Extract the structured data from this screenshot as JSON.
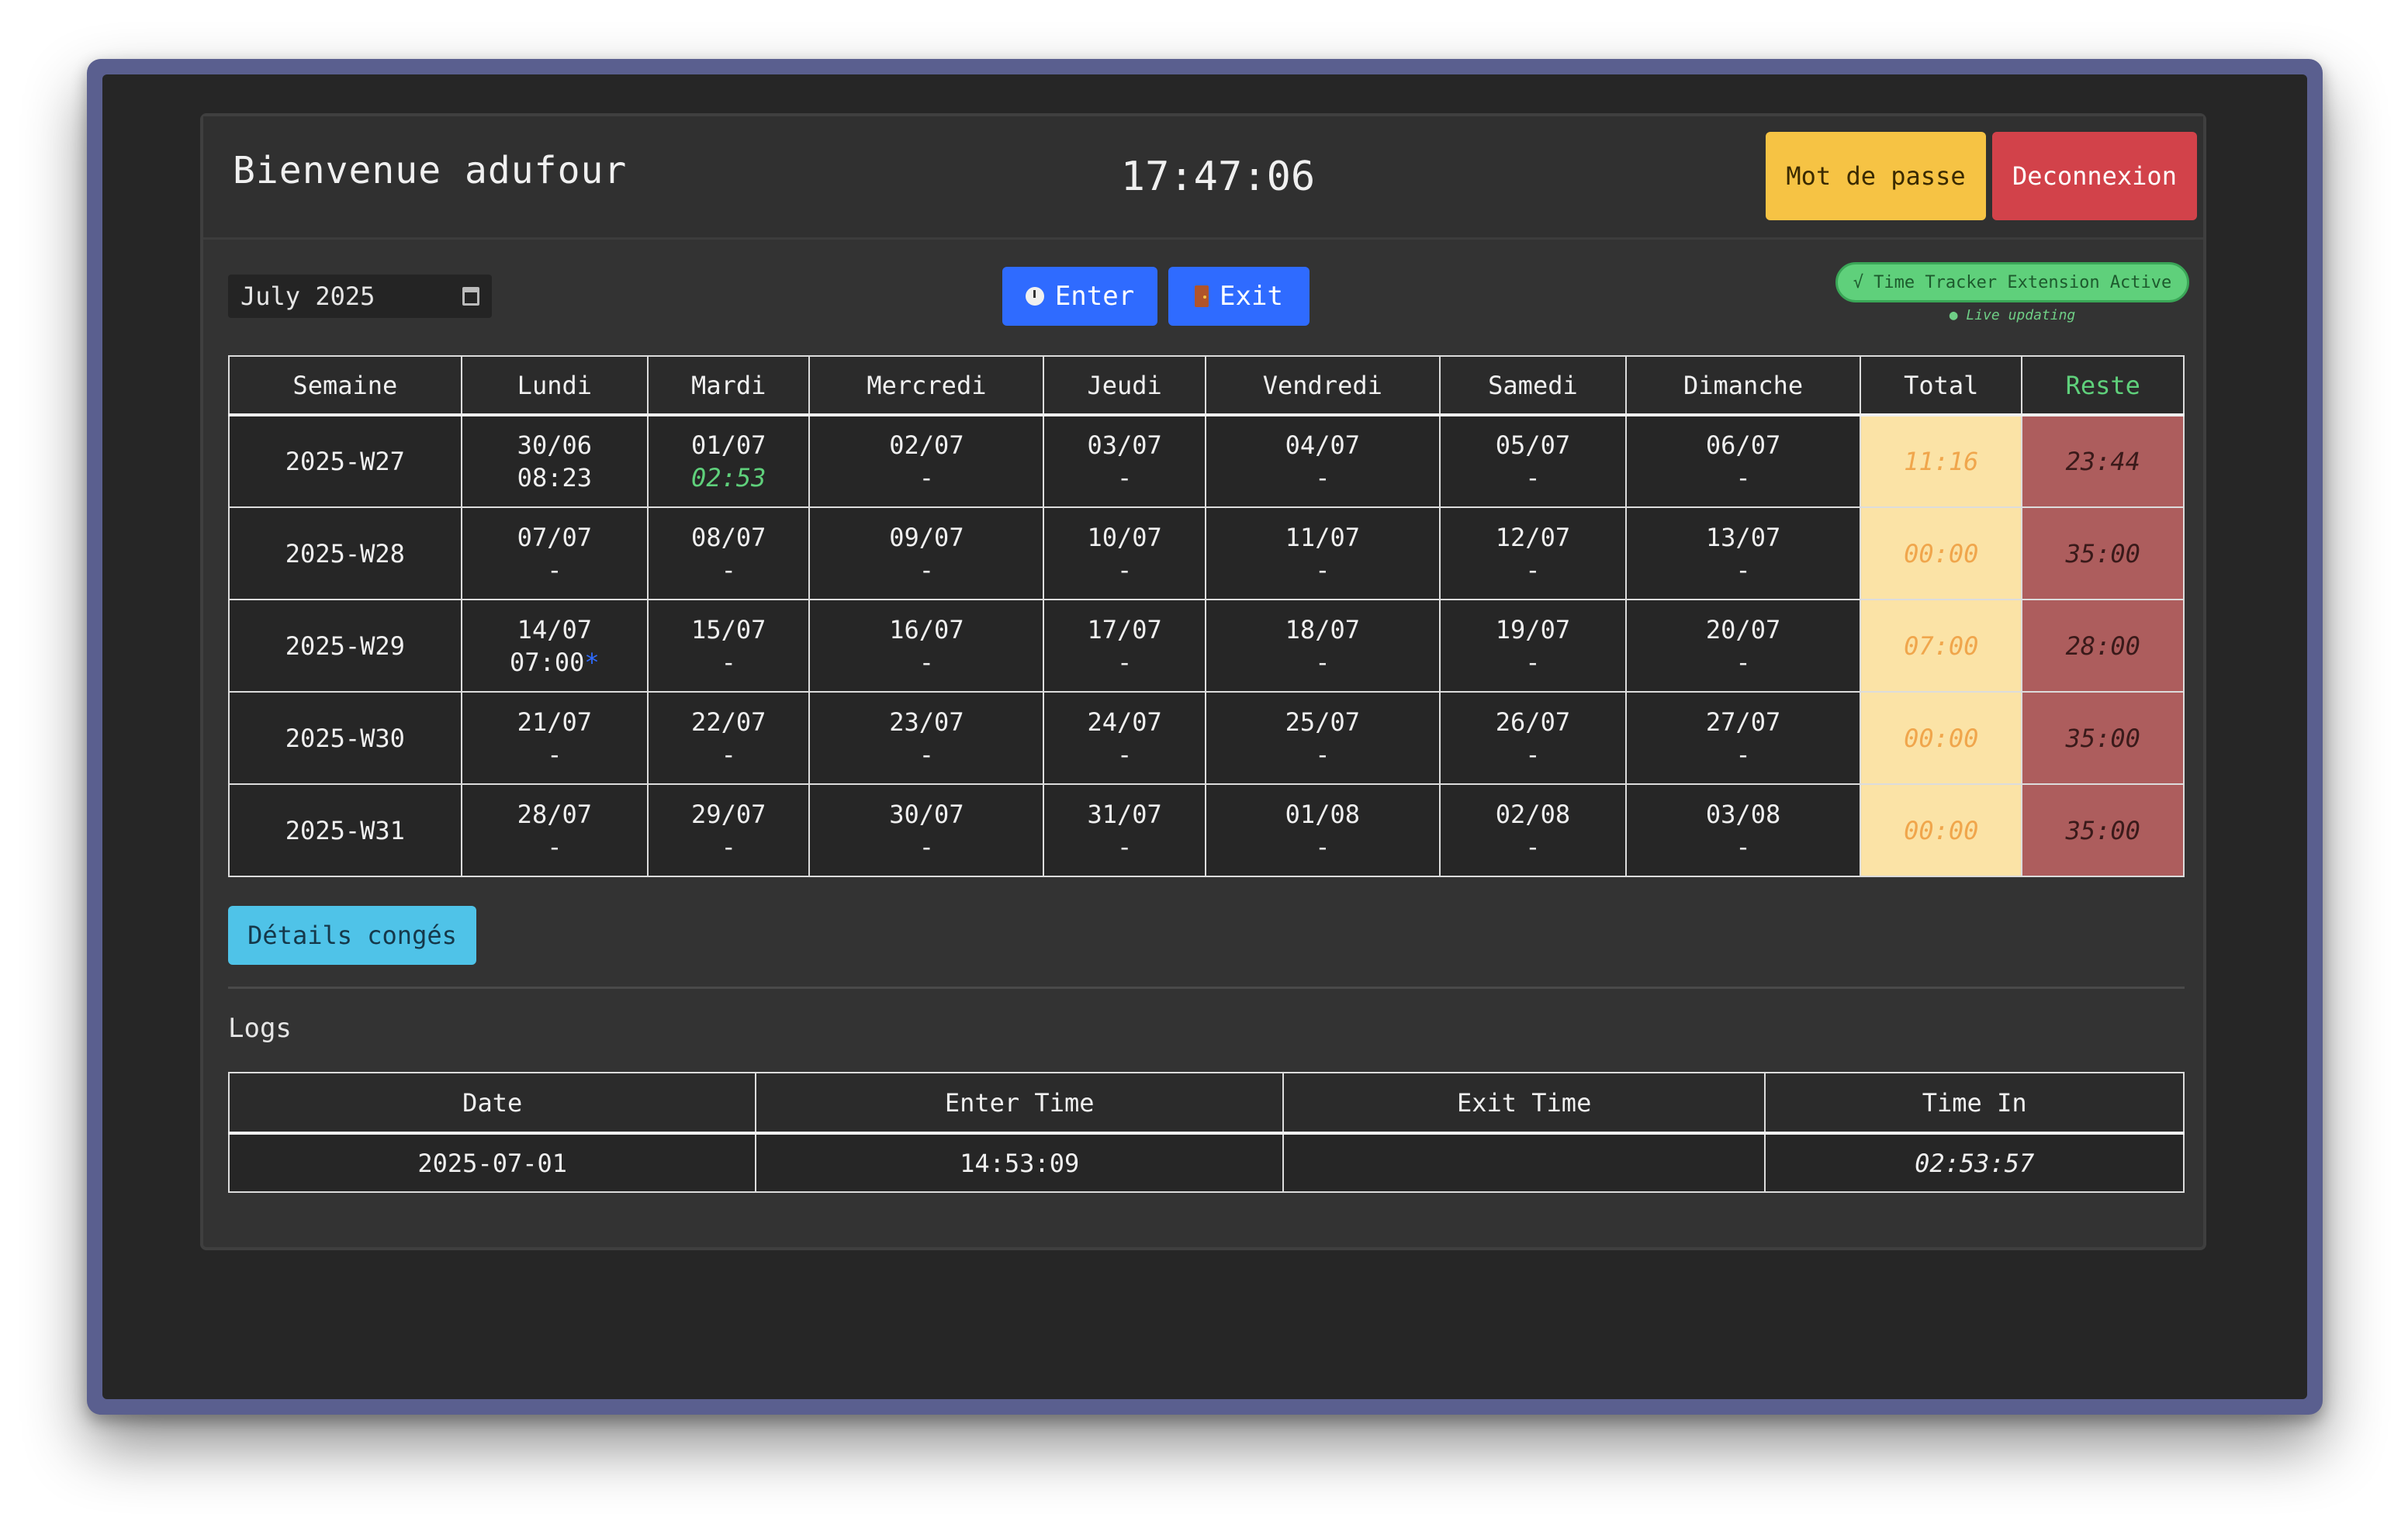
{
  "header": {
    "welcome": "Bienvenue adufour",
    "clock": "17:47:06",
    "password_label": "Mot de passe",
    "logout_label": "Deconnexion"
  },
  "toolbar": {
    "month_value": "July 2025",
    "enter_label": "Enter",
    "exit_label": "Exit",
    "extension_status": "√ Time Tracker Extension Active",
    "live_status": "● Live updating"
  },
  "calendar": {
    "headers": [
      "Semaine",
      "Lundi",
      "Mardi",
      "Mercredi",
      "Jeudi",
      "Vendredi",
      "Samedi",
      "Dimanche",
      "Total",
      "Reste"
    ],
    "weeks": [
      {
        "week": "2025-W27",
        "days": [
          {
            "date": "30/06",
            "time": "08:23"
          },
          {
            "date": "01/07",
            "time": "02:53"
          },
          {
            "date": "02/07",
            "time": "-"
          },
          {
            "date": "03/07",
            "time": "-"
          },
          {
            "date": "04/07",
            "time": "-"
          },
          {
            "date": "05/07",
            "time": "-"
          },
          {
            "date": "06/07",
            "time": "-"
          }
        ],
        "total": "11:16",
        "reste": "23:44"
      },
      {
        "week": "2025-W28",
        "days": [
          {
            "date": "07/07",
            "time": "-"
          },
          {
            "date": "08/07",
            "time": "-"
          },
          {
            "date": "09/07",
            "time": "-"
          },
          {
            "date": "10/07",
            "time": "-"
          },
          {
            "date": "11/07",
            "time": "-"
          },
          {
            "date": "12/07",
            "time": "-"
          },
          {
            "date": "13/07",
            "time": "-"
          }
        ],
        "total": "00:00",
        "reste": "35:00"
      },
      {
        "week": "2025-W29",
        "days": [
          {
            "date": "14/07",
            "time": "07:00",
            "mark": "*"
          },
          {
            "date": "15/07",
            "time": "-"
          },
          {
            "date": "16/07",
            "time": "-"
          },
          {
            "date": "17/07",
            "time": "-"
          },
          {
            "date": "18/07",
            "time": "-"
          },
          {
            "date": "19/07",
            "time": "-"
          },
          {
            "date": "20/07",
            "time": "-"
          }
        ],
        "total": "07:00",
        "reste": "28:00"
      },
      {
        "week": "2025-W30",
        "days": [
          {
            "date": "21/07",
            "time": "-"
          },
          {
            "date": "22/07",
            "time": "-"
          },
          {
            "date": "23/07",
            "time": "-"
          },
          {
            "date": "24/07",
            "time": "-"
          },
          {
            "date": "25/07",
            "time": "-"
          },
          {
            "date": "26/07",
            "time": "-"
          },
          {
            "date": "27/07",
            "time": "-"
          }
        ],
        "total": "00:00",
        "reste": "35:00"
      },
      {
        "week": "2025-W31",
        "days": [
          {
            "date": "28/07",
            "time": "-"
          },
          {
            "date": "29/07",
            "time": "-"
          },
          {
            "date": "30/07",
            "time": "-"
          },
          {
            "date": "31/07",
            "time": "-"
          },
          {
            "date": "01/08",
            "time": "-"
          },
          {
            "date": "02/08",
            "time": "-"
          },
          {
            "date": "03/08",
            "time": "-"
          }
        ],
        "total": "00:00",
        "reste": "35:00"
      }
    ]
  },
  "conges_label": "Détails congés",
  "logs": {
    "title": "Logs",
    "headers": [
      "Date",
      "Enter Time",
      "Exit Time",
      "Time In"
    ],
    "rows": [
      {
        "date": "2025-07-01",
        "enter": "14:53:09",
        "exit": "",
        "time_in": "02:53:57"
      }
    ]
  },
  "colors": {
    "enter_exit_blue": "#2f6bff",
    "password_yellow": "#f6c344",
    "logout_red": "#d2424a",
    "total_bg": "#fbe3a6",
    "reste_bg": "#ad5d5d",
    "extension_green": "#5fd07b",
    "conges_cyan": "#4fc3e8"
  }
}
